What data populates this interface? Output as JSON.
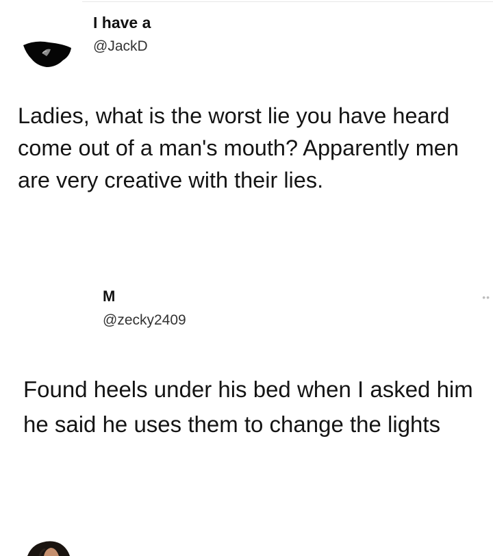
{
  "tweets": [
    {
      "display_name": "I have a",
      "handle": "@JackD",
      "avatar_icon": "user-avatar-dark-icon",
      "text": "Ladies, what is the worst lie you have heard come out of a man's mouth? Apparently men are very creative with their lies."
    },
    {
      "display_name": "M",
      "handle": "@zecky2409",
      "avatar_icon": "user-avatar-photo-icon",
      "more_icon": "more-options-icon",
      "text": "Found heels under his bed when I asked him he said he uses them to change the lights"
    }
  ]
}
